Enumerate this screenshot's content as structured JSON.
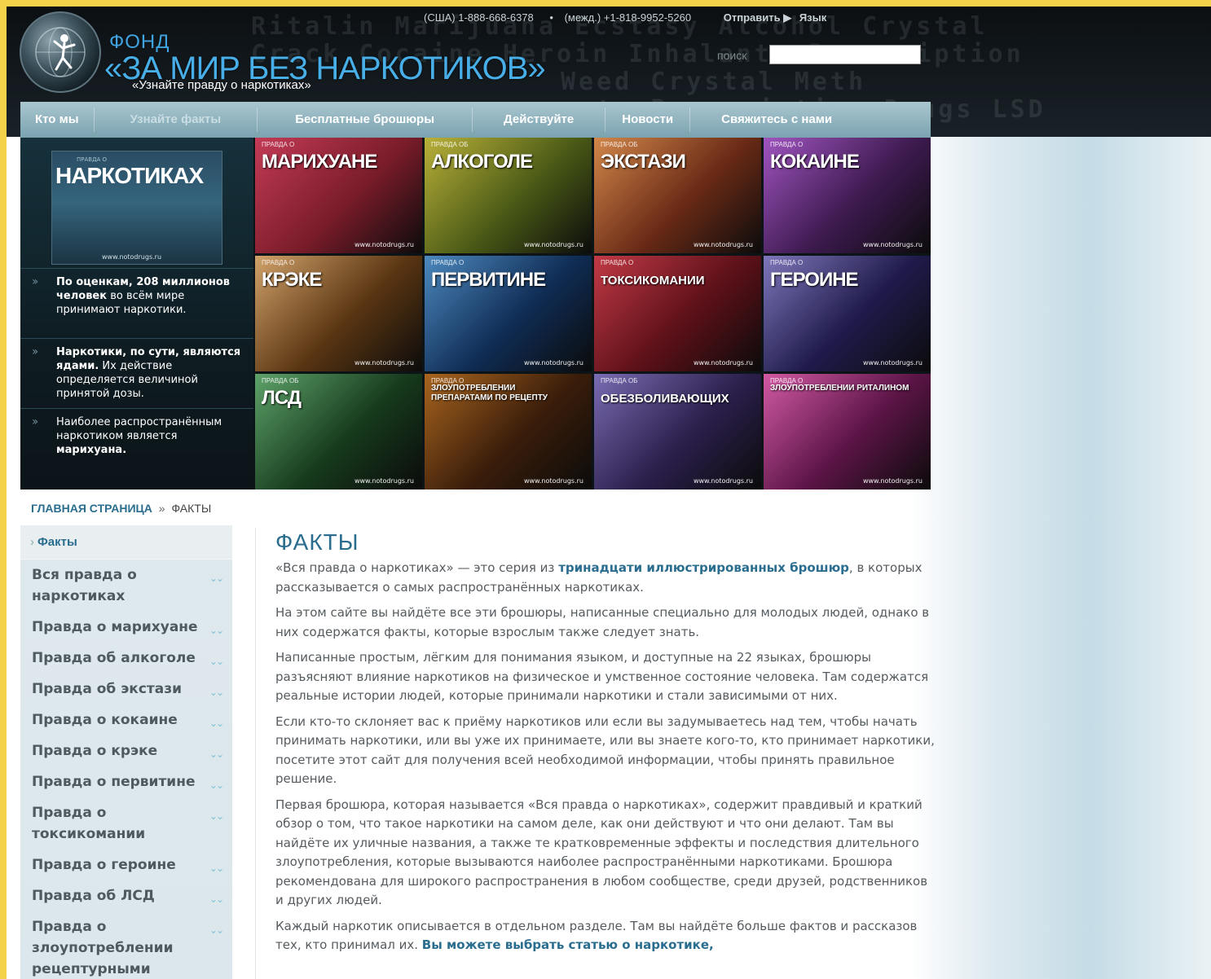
{
  "header": {
    "brand_small": "ФОНД",
    "brand_big": "«ЗА МИР БЕЗ НАРКОТИКОВ»",
    "tagline": "«Узнайте правду о наркотиках»",
    "phone_us": "(США) 1-888-668-6378",
    "phone_intl": "(межд.) +1-818-9952-5260",
    "send_label": "Отправить ▶",
    "lang_label": "Язык",
    "search_label": "поиск",
    "search_value": "",
    "bg_words_1": "Ritalin  Marijuana  Ecstasy  Alcohol  Crystal",
    "bg_words_2": "Crack  Cocaine  Heroin  Inhalants  Prescription",
    "bg_words_3": "Weed          Crystal  Meth",
    "bg_words_4": "ants  Prescription Drugs  LSD"
  },
  "nav": [
    {
      "label": "Кто мы"
    },
    {
      "label": "Узнайте факты"
    },
    {
      "label": "Бесплатные брошюры"
    },
    {
      "label": "Действуйте"
    },
    {
      "label": "Новости"
    },
    {
      "label": "Свяжитесь с нами"
    }
  ],
  "feature": {
    "kicker": "ПРАВДА О",
    "title": "НАРКОТИКАХ",
    "url": "www.notodrugs.ru",
    "facts": [
      {
        "bold": "По оценкам, 208 миллионов человек",
        "text": " во всём мире принимают наркотики."
      },
      {
        "bold": "Наркотики, по сути, являются ядами.",
        "text": " Их действие определяется величиной принятой дозы."
      },
      {
        "bold": "",
        "text": "Наиболее распространённым наркотиком является ",
        "bold2": "марихуана."
      }
    ]
  },
  "tiles": [
    {
      "kicker": "Правда о",
      "title": "МАРИХУАНЕ",
      "url": "www.notodrugs.ru",
      "color": "#7a1c2a",
      "color2": "#c43b57"
    },
    {
      "kicker": "Правда об",
      "title": "АЛКОГОЛЕ",
      "url": "www.notodrugs.ru",
      "color": "#4a5a16",
      "color2": "#b9b039"
    },
    {
      "kicker": "Правда об",
      "title": "ЭКСТАЗИ",
      "url": "www.notodrugs.ru",
      "color": "#6a2a16",
      "color2": "#d2874a"
    },
    {
      "kicker": "Правда о",
      "title": "КОКАИНЕ",
      "url": "www.notodrugs.ru",
      "color": "#3d1a4f",
      "color2": "#a055c0"
    },
    {
      "kicker": "Правда о",
      "title": "КРЭКЕ",
      "url": "www.notodrugs.ru",
      "color": "#5a3512",
      "color2": "#d1a26a"
    },
    {
      "kicker": "Правда о",
      "title": "ПЕРВИТИНЕ",
      "url": "www.notodrugs.ru",
      "color": "#0f2c54",
      "color2": "#4d89bf"
    },
    {
      "kicker": "Правда о",
      "title": "ТОКСИКОМАНИИ",
      "url": "www.notodrugs.ru",
      "color": "#5c1018",
      "color2": "#c13a46"
    },
    {
      "kicker": "Правда о",
      "title": "ГЕРОИНЕ",
      "url": "www.notodrugs.ru",
      "color": "#1f1a4a",
      "color2": "#7e77bb"
    },
    {
      "kicker": "Правда об",
      "title": "ЛСД",
      "url": "www.notodrugs.ru",
      "color": "#163a1c",
      "color2": "#5ea36a"
    },
    {
      "kicker": "Правда о",
      "title": "ЗЛОУПОТРЕБЛЕНИИ ПРЕПАРАТАМИ ПО РЕЦЕПТУ",
      "url": "www.notodrugs.ru",
      "color": "#3a1d0a",
      "color2": "#a9651f"
    },
    {
      "kicker": "Правда об",
      "title": "ОБЕЗБОЛИВАЮЩИХ",
      "url": "www.notodrugs.ru",
      "color": "#2b1f4c",
      "color2": "#7a6cb2"
    },
    {
      "kicker": "Правда о",
      "title": "ЗЛОУПОТРЕБЛЕНИИ РИТАЛИНОМ",
      "url": "www.notodrugs.ru",
      "color": "#5b1446",
      "color2": "#d25aa4"
    }
  ],
  "breadcrumb": {
    "home": "ГЛАВНАЯ СТРАНИЦА",
    "sep": "»",
    "current": "ФАКТЫ"
  },
  "sidebar": {
    "head": "Факты",
    "items": [
      "Вся правда о наркотиках",
      "Правда о марихуане",
      "Правда об алкоголе",
      "Правда об экстази",
      "Правда о кокаине",
      "Правда о крэке",
      "Правда о первитине",
      "Правда о токсикомании",
      "Правда о героине",
      "Правда об ЛСД",
      "Правда о злоупотреблении рецептурными"
    ]
  },
  "content": {
    "title": "ФАКТЫ",
    "p1_a": "«Вся правда о наркотиках» — это серия из ",
    "p1_hl": "тринадцати иллюстрированных брошюр",
    "p1_b": ", в которых рассказывается о самых распространённых наркотиках.",
    "p2": "На этом сайте вы найдёте все эти брошюры, написанные специально для молодых людей, однако в них содержатся факты, которые взрослым также следует знать.",
    "p3": "Написанные простым, лёгким для понимания языком, и доступные на 22 языках, брошюры разъясняют влияние наркотиков на физическое и умственное состояние человека. Там содержатся реальные истории людей, которые принимали наркотики и стали зависимыми от них.",
    "p4": "Если кто-то склоняет вас к приёму наркотиков или если вы задумываетесь над тем, чтобы начать принимать наркотики, или вы уже их принимаете, или вы знаете кого-то, кто принимает наркотики, посетите этот сайт для получения всей необходимой информации, чтобы принять правильное решение.",
    "p5": "Первая брошюра, которая называется «Вся правда о наркотиках», содержит правдивый и краткий обзор о том, что такое наркотики на самом деле, как они действуют и что они делают. Там вы найдёте их уличные названия, а также те кратковременные эффекты и последствия длительного злоупотребления, которые вызываются наиболее распространёнными наркотиками. Брошюра рекомендована для широкого распространения в любом сообществе, среди друзей, родственников и других людей.",
    "p6_a": "Каждый наркотик описывается в отдельном разделе. Там вы найдёте больше фактов и рассказов тех, кто принимал их. ",
    "p6_hl": "Вы можете выбрать статью о наркотике,"
  }
}
